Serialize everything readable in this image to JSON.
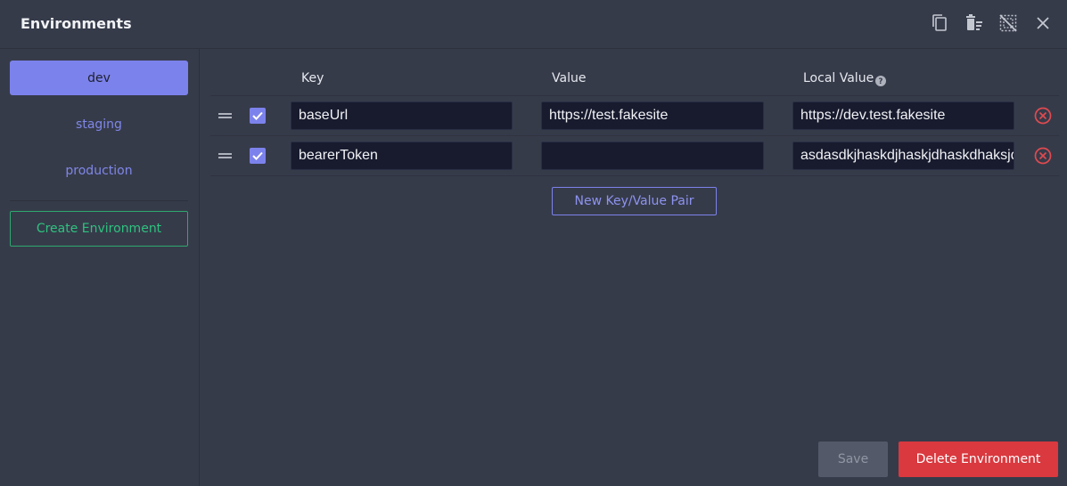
{
  "header": {
    "title": "Environments",
    "icons": [
      "copy-icon",
      "clear-icon",
      "deselect-icon",
      "close-icon"
    ]
  },
  "sidebar": {
    "environments": [
      {
        "label": "dev",
        "active": true
      },
      {
        "label": "staging",
        "active": false
      },
      {
        "label": "production",
        "active": false
      }
    ],
    "create_label": "Create Environment"
  },
  "table": {
    "columns": {
      "key": "Key",
      "value": "Value",
      "local_value": "Local Value"
    },
    "rows": [
      {
        "enabled": true,
        "key": "baseUrl",
        "value": "https://test.fakesite",
        "local_value": "https://dev.test.fakesite"
      },
      {
        "enabled": true,
        "key": "bearerToken",
        "value": "",
        "local_value": "asdasdkjhaskdjhaskjdhaskdhaksjdhkasjdh"
      }
    ],
    "new_pair_label": "New Key/Value Pair"
  },
  "footer": {
    "save_label": "Save",
    "delete_label": "Delete Environment"
  },
  "colors": {
    "accent": "#7c82eb",
    "success": "#2ec27e",
    "danger": "#d9393f",
    "background": "#363b4a"
  }
}
